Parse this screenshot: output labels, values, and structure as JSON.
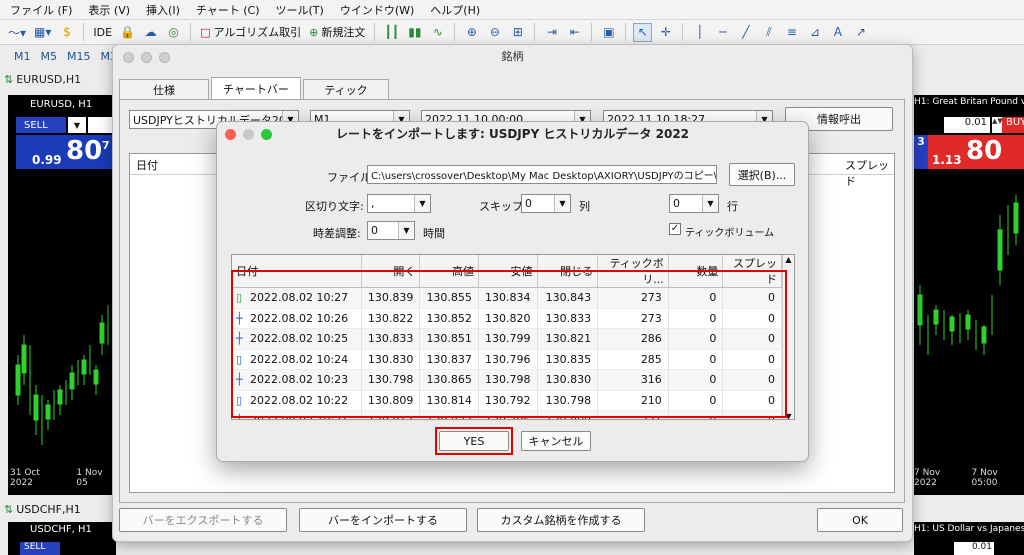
{
  "menu": [
    "ファイル (F)",
    "表示 (V)",
    "挿入(I)",
    "チャート (C)",
    "ツール(T)",
    "ウインドウ(W)",
    "ヘルプ(H)"
  ],
  "toolbar": {
    "ide": "IDE",
    "algo": "アルゴリズム取引",
    "new_order": "新規注文"
  },
  "timeframes": [
    "M1",
    "M5",
    "M15",
    "M3"
  ],
  "charts": {
    "eurusd_tab": "EURUSD,H1",
    "eurusd_title": "EURUSD, H1",
    "usdchf_tab": "USDCHF,H1",
    "usdchf_title": "USDCHF, H1",
    "sell": "SELL",
    "buy": "BUY",
    "bid_small": "0.99",
    "bid_big": "80",
    "bid_sup": "7",
    "ask_small": "1.13",
    "ask_big": "80",
    "ask_sup": "3",
    "lot": "0.01",
    "lot2": "0.01",
    "right_title": "H1: Great Britan Pound vs",
    "right_title2": "H1: US Dollar vs Japanese",
    "date_left_1": "31 Oct 2022",
    "date_left_2": "1 Nov 05",
    "date_right_1": "7 Nov 2022",
    "date_right_2": "7 Nov 05:00"
  },
  "symbols_window": {
    "title": "銘柄",
    "tabs": [
      "仕様",
      "チャートバー",
      "ティック"
    ],
    "symbol_select": "USDJPYヒストリカルデータ2022",
    "period_select": "M1",
    "from_date": "2022.11.10 00:00",
    "to_date": "2022.11.10 18:27",
    "request_button": "情報呼出",
    "col_date": "日付",
    "col_spread": "スプレッド",
    "export_button": "バーをエクスポートする",
    "import_button": "バーをインポートする",
    "custom_button": "カスタム銘柄を作成する",
    "ok_button": "OK"
  },
  "import_dialog": {
    "title": "レートをインポートします: USDJPY ヒストリカルデータ 2022",
    "file_label": "ファイル:",
    "file_path": "C:\\users\\crossover\\Desktop\\My Mac Desktop\\AXIORY\\USDJPYのコピー\\USD",
    "select_button": "選択(B)...",
    "delimiter_label": "区切り文字:",
    "delimiter_value": ",",
    "skip_label": "スキップ:",
    "skip_value": "0",
    "col_label": "列",
    "row_value": "0",
    "row_label": "行",
    "time_label": "時差調整:",
    "time_value": "0",
    "time_unit": "時間",
    "tick_volume_label": "ティックボリューム",
    "tick_volume_checked": true,
    "columns": [
      "日付",
      "開く",
      "高値",
      "安値",
      "閉じる",
      "ティックボリ...",
      "数量",
      "スプレッド"
    ],
    "rows": [
      [
        "2022.08.02 10:27",
        "130.839",
        "130.855",
        "130.834",
        "130.843",
        "273",
        "0",
        "0"
      ],
      [
        "2022.08.02 10:26",
        "130.822",
        "130.852",
        "130.820",
        "130.833",
        "273",
        "0",
        "0"
      ],
      [
        "2022.08.02 10:25",
        "130.833",
        "130.851",
        "130.799",
        "130.821",
        "286",
        "0",
        "0"
      ],
      [
        "2022.08.02 10:24",
        "130.830",
        "130.837",
        "130.796",
        "130.835",
        "285",
        "0",
        "0"
      ],
      [
        "2022.08.02 10:23",
        "130.798",
        "130.865",
        "130.798",
        "130.830",
        "316",
        "0",
        "0"
      ],
      [
        "2022.08.02 10:22",
        "130.809",
        "130.814",
        "130.792",
        "130.798",
        "210",
        "0",
        "0"
      ],
      [
        "2022.08.02 10:21",
        "130.817",
        "130.822",
        "130.796",
        "130.809",
        "231",
        "0",
        "0"
      ]
    ],
    "yes_button": "YES",
    "cancel_button": "キャンセル"
  }
}
